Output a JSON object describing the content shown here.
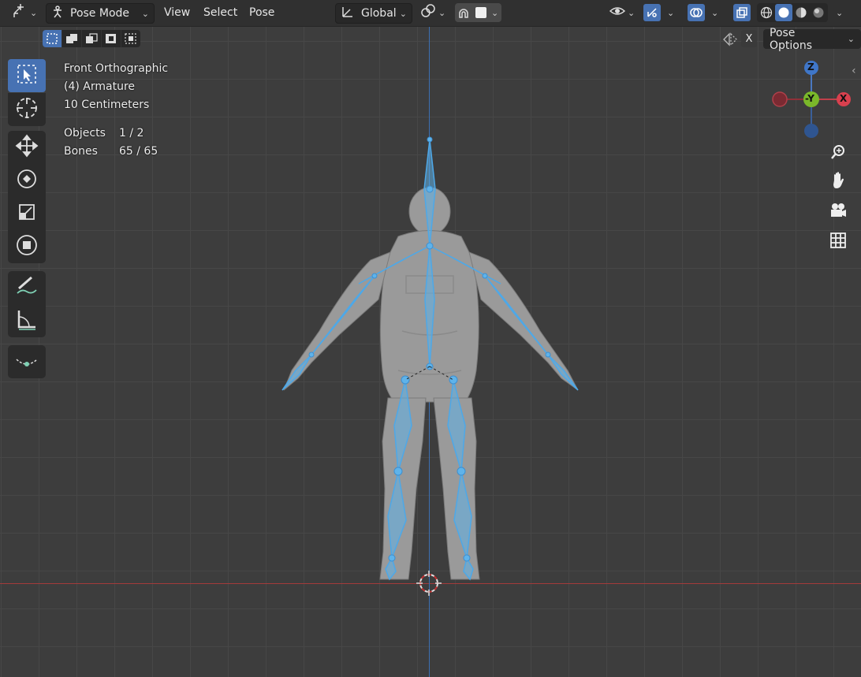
{
  "header": {
    "mode_label": "Pose Mode",
    "menus": [
      "View",
      "Select",
      "Pose"
    ],
    "transform_orientation": "Global"
  },
  "subheader": {
    "pose_options_label": "Pose Options",
    "x_mirror_label": "X"
  },
  "overlay_info": {
    "view_name": "Front Orthographic",
    "object_name": "(4) Armature",
    "grid_scale": "10 Centimeters",
    "objects_label": "Objects",
    "objects_value": "1 / 2",
    "bones_label": "Bones",
    "bones_value": "65 / 65"
  },
  "gizmo": {
    "z_label": "Z",
    "y_label": "-Y",
    "x_label": "X"
  },
  "colors": {
    "bone_blue": "#4da8e8",
    "x_axis": "#a33b3b",
    "z_axis": "#3b6fb3",
    "active_tool": "#4772b3"
  },
  "icons": [
    "editor-type-icon",
    "pose-mode-icon",
    "orientation-icon",
    "pivot-icon",
    "snap-icon",
    "proportional-icon",
    "visibility-icon",
    "gizmo-icon",
    "overlay-icon",
    "xray-icon",
    "wireframe-shading-icon",
    "solid-shading-icon",
    "material-shading-icon",
    "rendered-shading-icon",
    "select-box-icon",
    "cursor-icon",
    "move-icon",
    "rotate-icon",
    "scale-icon",
    "transform-icon",
    "annotate-icon",
    "measure-icon",
    "relax-icon",
    "zoom-icon",
    "pan-icon",
    "camera-icon",
    "grid-icon"
  ]
}
